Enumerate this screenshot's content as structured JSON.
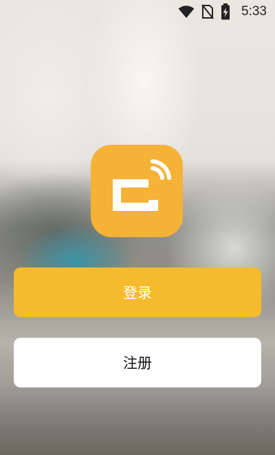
{
  "status_bar": {
    "time": "5:33",
    "icons": [
      "wifi-icon",
      "no-sim-icon",
      "battery-charging-icon"
    ]
  },
  "app": {
    "logo_icon": "app-logo-icon",
    "logo_color": "#f6b137"
  },
  "buttons": {
    "login_label": "登录",
    "register_label": "注册"
  },
  "colors": {
    "login_button": "#f5bb2c",
    "register_button": "#ffffff"
  }
}
